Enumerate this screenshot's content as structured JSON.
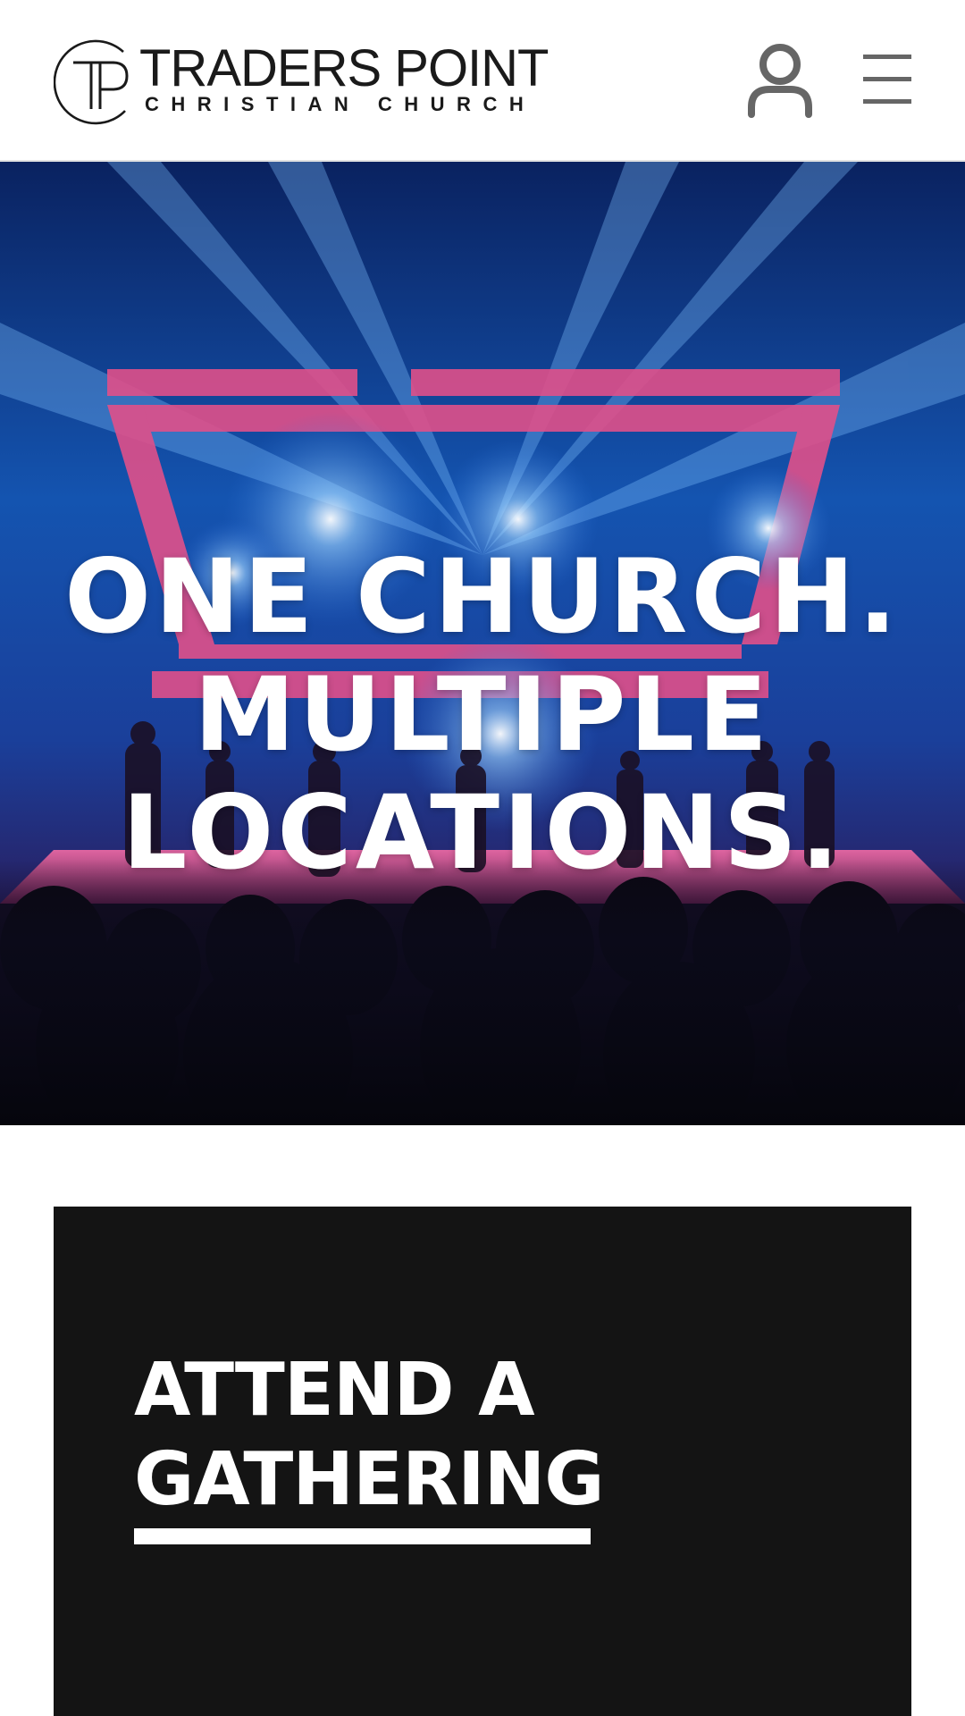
{
  "header": {
    "logo": {
      "monogram": "TP",
      "name": "TRADERS POINT",
      "subtitle": "CHRISTIAN CHURCH"
    },
    "account_icon": "user-icon",
    "menu_icon": "hamburger-menu-icon"
  },
  "hero": {
    "title_lines": [
      "ONE CHURCH.",
      "MULTIPLE",
      "LOCATIONS."
    ]
  },
  "card": {
    "heading_lines": [
      "ATTEND A",
      "GATHERING"
    ]
  },
  "colors": {
    "header_bg": "#ffffff",
    "icon_gray": "#666666",
    "card_bg": "#141414",
    "text_light": "#ffffff",
    "stage_pink": "#e0508a",
    "stage_blue": "#2a6fd8"
  }
}
